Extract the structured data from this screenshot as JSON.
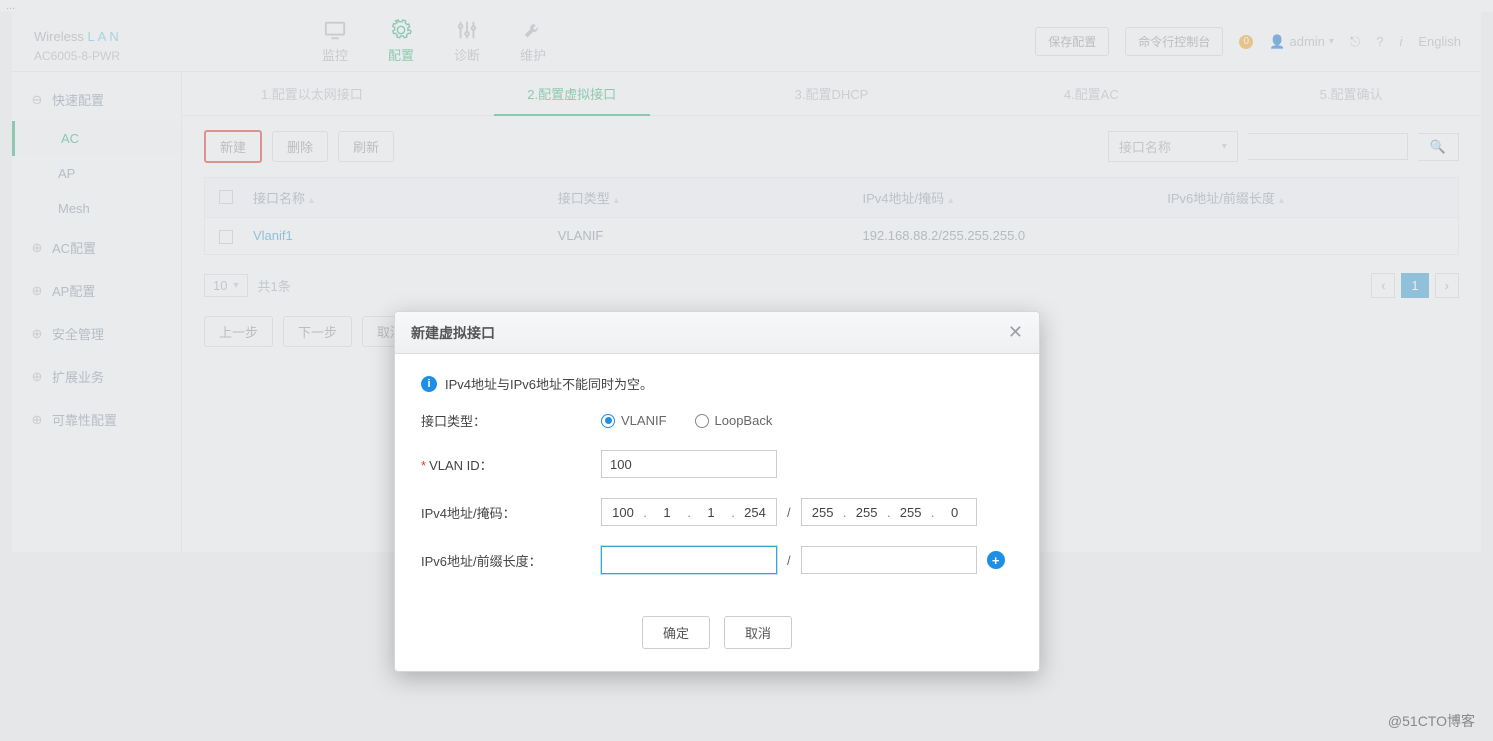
{
  "topcrop_text": "...",
  "brand": {
    "title_a": "Wireless ",
    "title_b": "LAN",
    "sub": "AC6005-8-PWR"
  },
  "nav": {
    "monitor": "监控",
    "config": "配置",
    "diag": "诊断",
    "maintain": "维护"
  },
  "header_buttons": {
    "save": "保存配置",
    "cli": "命令行控制台",
    "user": "admin",
    "lang": "English"
  },
  "side": {
    "quick": "快速配置",
    "sub_ac": "AC",
    "sub_ap": "AP",
    "sub_mesh": "Mesh",
    "ac_cfg": "AC配置",
    "ap_cfg": "AP配置",
    "sec": "安全管理",
    "ext": "扩展业务",
    "rel": "可靠性配置"
  },
  "steps": {
    "s1": "1.配置以太网接口",
    "s2": "2.配置虚拟接口",
    "s3": "3.配置DHCP",
    "s4": "4.配置AC",
    "s5": "5.配置确认"
  },
  "toolbar": {
    "new": "新建",
    "del": "删除",
    "ref": "刷新",
    "search_sel": "接口名称"
  },
  "table": {
    "h1": "接口名称",
    "h2": "接口类型",
    "h3": "IPv4地址/掩码",
    "h4": "IPv6地址/前缀长度",
    "r1": {
      "name": "Vlanif1",
      "type": "VLANIF",
      "v4": "192.168.88.2/255.255.255.0",
      "v6": ""
    }
  },
  "pager": {
    "size": "10",
    "total": "共1条",
    "page": "1"
  },
  "foot": {
    "prev": "上一步",
    "next": "下一步",
    "cancel": "取消"
  },
  "modal": {
    "title": "新建虚拟接口",
    "info": "IPv4地址与IPv6地址不能同时为空。",
    "lbl_type": "接口类型：",
    "opt_vlanif": "VLANIF",
    "opt_loop": "LoopBack",
    "lbl_vlan": "VLAN ID：",
    "vlan_val": "100",
    "lbl_v4": "IPv4地址/掩码：",
    "v4": {
      "o1": "100",
      "o2": "1",
      "o3": "1",
      "o4": "254"
    },
    "mask": {
      "o1": "255",
      "o2": "255",
      "o3": "255",
      "o4": "0"
    },
    "lbl_v6": "IPv6地址/前缀长度：",
    "ok": "确定",
    "cancel": "取消"
  },
  "watermark": "@51CTO博客"
}
